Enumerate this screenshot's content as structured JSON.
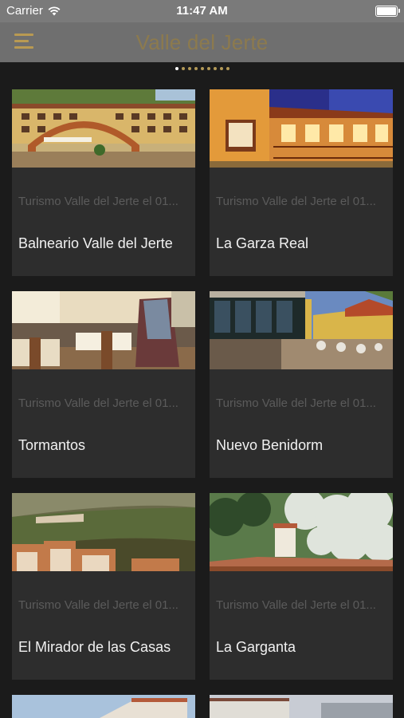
{
  "status_bar": {
    "carrier": "Carrier",
    "time": "11:47 AM",
    "icons": [
      "wifi-icon",
      "battery-icon"
    ]
  },
  "nav": {
    "title": "Valle del Jerte",
    "menu_icon": "hamburger-menu-icon"
  },
  "pager": {
    "count": 9,
    "active": 0
  },
  "cards": [
    {
      "subtitle": "Turismo Valle del Jerte el 01...",
      "title": "Balneario Valle del Jerte"
    },
    {
      "subtitle": "Turismo Valle del Jerte el 01...",
      "title": "La Garza Real"
    },
    {
      "subtitle": "Turismo Valle del Jerte el 01...",
      "title": "Tormantos"
    },
    {
      "subtitle": "Turismo Valle del Jerte el 01...",
      "title": "Nuevo Benidorm"
    },
    {
      "subtitle": "Turismo Valle del Jerte el 01...",
      "title": "El Mirador de las Casas"
    },
    {
      "subtitle": "Turismo Valle del Jerte el 01...",
      "title": "La Garganta"
    }
  ],
  "colors": {
    "accent": "#b99a52",
    "background": "#1b1b1b",
    "card": "#2d2d2d",
    "navbar": "#6f6f6f"
  }
}
